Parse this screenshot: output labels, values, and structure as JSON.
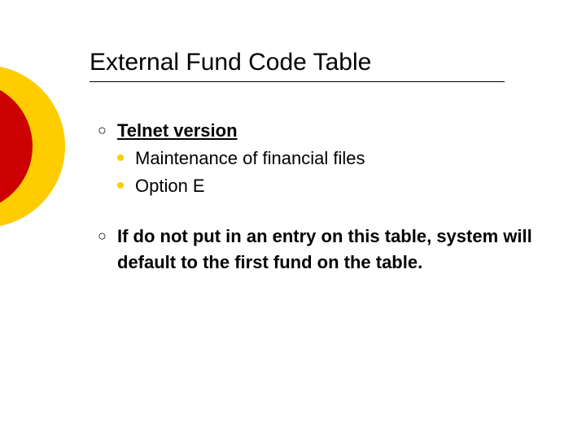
{
  "title": "External Fund Code Table",
  "items": [
    {
      "text": "Telnet version",
      "underline": true,
      "sub": [
        {
          "text": "Maintenance of financial files"
        },
        {
          "text": "Option E"
        }
      ]
    },
    {
      "text": "If do not put in an entry on this table, system will default to the first fund on the table.",
      "underline": false,
      "sub": []
    }
  ]
}
